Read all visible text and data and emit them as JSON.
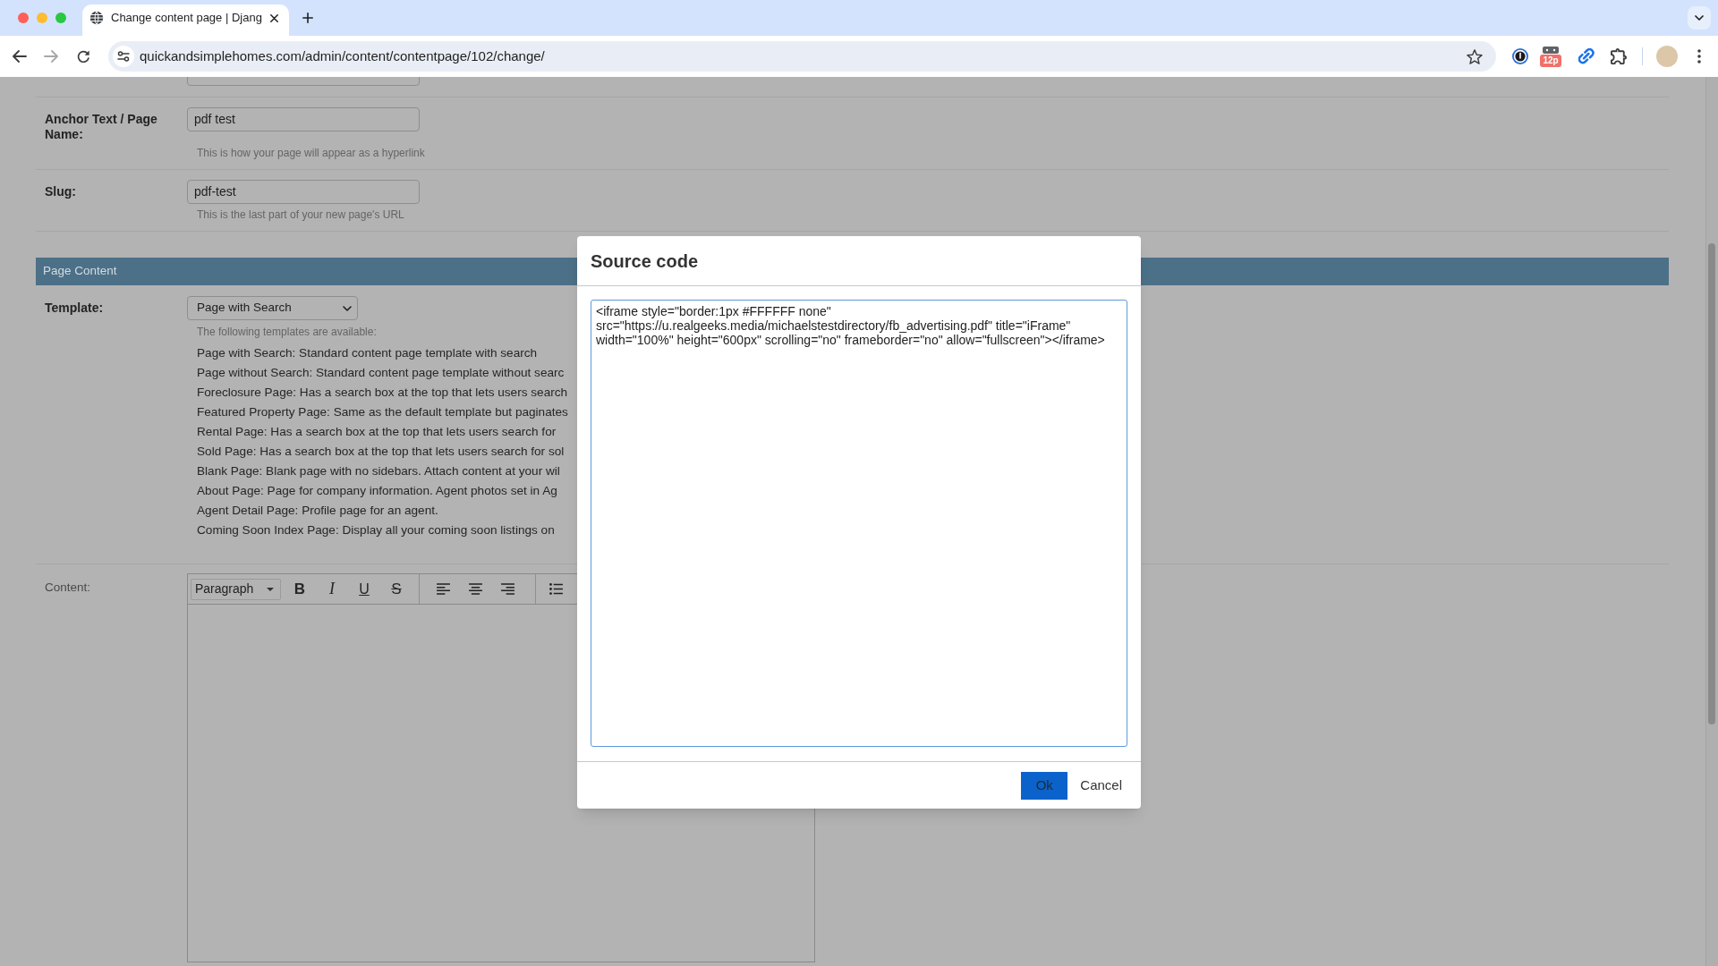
{
  "browser": {
    "tabs": [
      {
        "title": "Change content page | Djang",
        "selected": true
      }
    ],
    "url": "quickandsimplehomes.com/admin/content/contentpage/102/change/",
    "extension_badge": "12p"
  },
  "form": {
    "fields": [
      {
        "label": "Anchor Text / Page Name:",
        "value": "pdf test",
        "help": "This is how your page will appear as a hyperlink"
      },
      {
        "label": "Slug:",
        "value": "pdf-test",
        "help": "This is the last part of your new page's URL"
      }
    ],
    "section": {
      "title": "Page Content"
    },
    "template": {
      "label": "Template:",
      "value": "Page with Search",
      "help": "The following templates are available:",
      "descriptions": [
        "Page with Search: Standard content page template with search",
        "Page without Search: Standard content page template without searc",
        "Foreclosure Page: Has a search box at the top that lets users search",
        "Featured Property Page: Same as the default template but paginates",
        "Rental Page: Has a search box at the top that lets users search for",
        "Sold Page: Has a search box at the top that lets users search for sol",
        "Blank Page: Blank page with no sidebars. Attach content at your wil",
        "About Page: Page for company information. Agent photos set in Ag",
        "Agent Detail Page: Profile page for an agent.",
        "Coming Soon Index Page: Display all your coming soon listings on"
      ]
    },
    "content": {
      "label": "Content:",
      "block_format": "Paragraph",
      "format_buttons": [
        {
          "kind": "bold",
          "glyph": "B"
        },
        {
          "kind": "italic",
          "glyph": "I"
        },
        {
          "kind": "underline",
          "glyph": "U"
        },
        {
          "kind": "strikethrough",
          "glyph": "S"
        }
      ]
    }
  },
  "modal": {
    "title": "Source code",
    "code": "<iframe style=\"border:1px #FFFFFF none\" src=\"https://u.realgeeks.media/michaelstestdirectory/fb_advertising.pdf\" title=\"iFrame\" width=\"100%\" height=\"600px\" scrolling=\"no\" frameborder=\"no\" allow=\"fullscreen\"></iframe>",
    "buttons": [
      {
        "label": "Ok",
        "kind": "confirm"
      },
      {
        "label": "Cancel",
        "kind": "cancel"
      }
    ]
  }
}
